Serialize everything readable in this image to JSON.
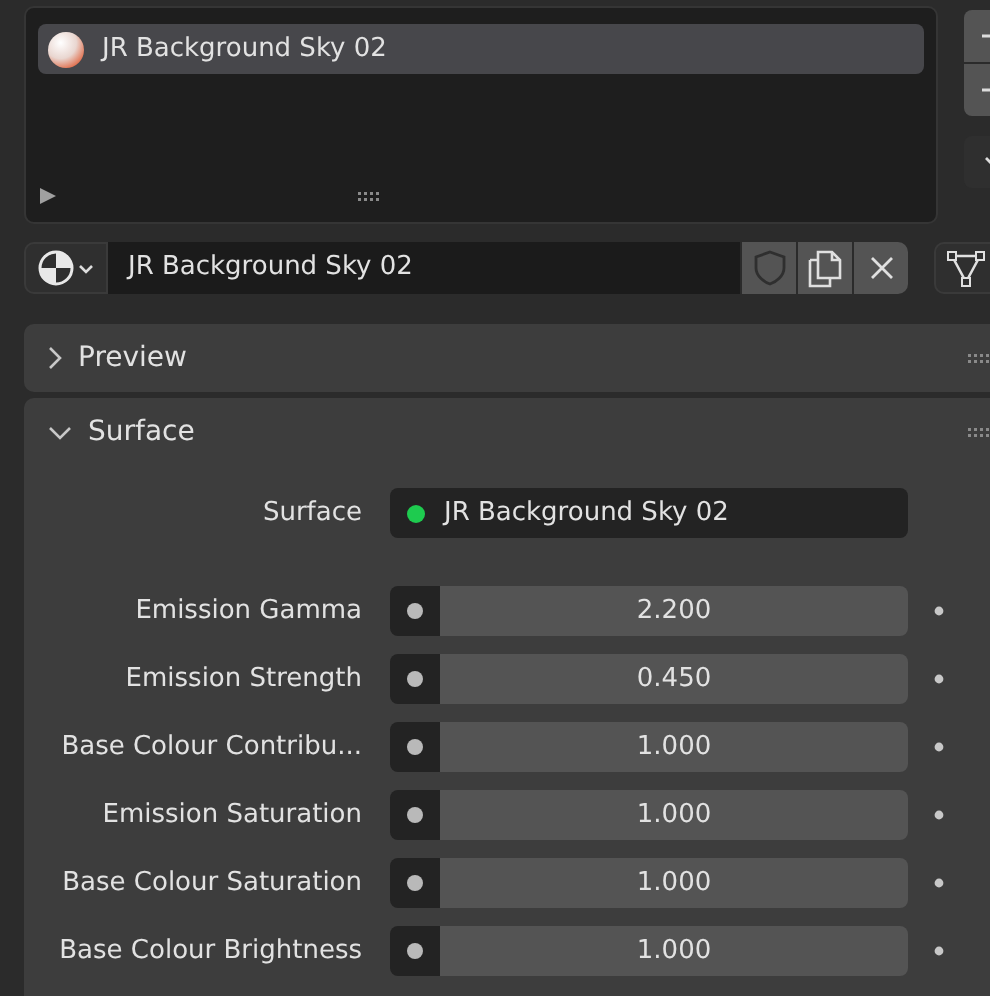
{
  "material_slots": {
    "items": [
      {
        "name": "JR Background Sky 02",
        "selected": true
      }
    ]
  },
  "material": {
    "name": "JR Background Sky 02"
  },
  "panels": [
    {
      "title": "Preview",
      "expanded": false
    },
    {
      "title": "Surface",
      "expanded": true
    }
  ],
  "surface": {
    "label": "Surface",
    "value": "JR Background Sky 02"
  },
  "properties": [
    {
      "label": "Emission Gamma",
      "value": "2.200"
    },
    {
      "label": "Emission Strength",
      "value": "0.450"
    },
    {
      "label": "Base Colour Contribu...",
      "value": "1.000"
    },
    {
      "label": "Emission Saturation",
      "value": "1.000"
    },
    {
      "label": "Base Colour Saturation",
      "value": "1.000"
    },
    {
      "label": "Base Colour Brightness",
      "value": "1.000"
    }
  ]
}
